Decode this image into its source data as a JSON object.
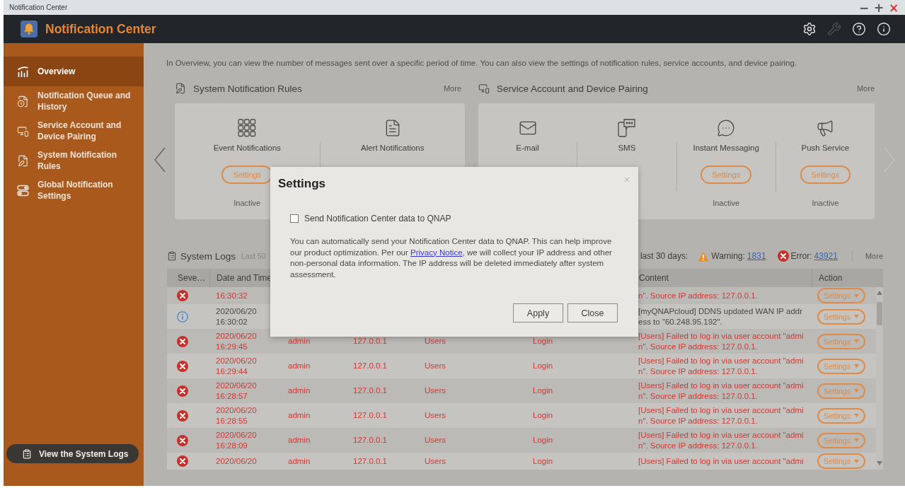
{
  "window": {
    "title": "Notification Center",
    "controls": [
      {
        "kind": "minimize",
        "glyph": "−"
      },
      {
        "kind": "maximize",
        "glyph": "+"
      },
      {
        "kind": "close",
        "glyph": "×"
      }
    ]
  },
  "header": {
    "title": "Notification Center",
    "tools": [
      {
        "kind": "settings",
        "disabled": false
      },
      {
        "kind": "tools",
        "disabled": true
      },
      {
        "kind": "help",
        "disabled": false
      },
      {
        "kind": "info",
        "disabled": false
      }
    ]
  },
  "sidebar": {
    "items": [
      {
        "kind": "overview",
        "label": "Overview",
        "selected": true
      },
      {
        "kind": "history",
        "label": "Notification Queue and History",
        "selected": false
      },
      {
        "kind": "devices",
        "label": "Service Account and Device Pairing",
        "selected": false
      },
      {
        "kind": "rules",
        "label": "System Notification Rules",
        "selected": false
      },
      {
        "kind": "toggles",
        "label": "Global Notification Settings",
        "selected": false
      }
    ],
    "footer_button": "View the System Logs"
  },
  "overview": {
    "description": "In Overview, you can view the number of messages sent over a specific period of time. You can also view the settings of notification rules, service accounts, and device pairing.",
    "carousel": [
      {
        "kind": "previous",
        "disabled": false
      },
      {
        "kind": "next",
        "disabled": true
      }
    ],
    "sections": [
      {
        "kind": "rules",
        "title": "System Notification Rules",
        "more": "More",
        "items": [
          {
            "kind": "event",
            "label": "Event Notifications",
            "button": "Settings",
            "status": "Inactive"
          },
          {
            "kind": "alert",
            "label": "Alert Notifications"
          }
        ]
      },
      {
        "kind": "devices",
        "title": "Service Account and Device Pairing",
        "more": "More",
        "items": [
          {
            "kind": "email",
            "label": "E-mail"
          },
          {
            "kind": "sms",
            "label": "SMS"
          },
          {
            "kind": "chat",
            "label": "Instant Messaging",
            "button": "Settings",
            "status": "Inactive"
          },
          {
            "kind": "push",
            "label": "Push Service",
            "button": "Settings",
            "status": "Inactive"
          }
        ]
      }
    ]
  },
  "system_logs": {
    "title": "System Logs",
    "subtitle": "Last 50",
    "summary": "last 30 days:",
    "counts": [
      {
        "kind": "warning",
        "label": "Warning:",
        "value": "1831"
      },
      {
        "kind": "error",
        "label": "Error:",
        "value": "43921"
      }
    ],
    "more": "More",
    "columns": {
      "severity": "Seve…",
      "date_time": "Date and Time",
      "content": "Content",
      "action": "Action"
    },
    "rows": [
      {
        "kind": "error",
        "time": "16:30:32",
        "content": "n\". Source IP address: 127.0.0.1.",
        "action": "Settings"
      },
      {
        "kind": "info",
        "date": "2020/06/20",
        "time": "16:30:02",
        "content": "[myQNAPcloud] DDNS updated WAN IP address to \"60.248.95.192\".",
        "action": "Settings"
      },
      {
        "kind": "error",
        "date": "2020/06/20",
        "time": "16:29:45",
        "user": "admin",
        "ip": "127.0.0.1",
        "category": "Users",
        "application": "Login",
        "content": "[Users] Failed to log in via user account \"admin\". Source IP address: 127.0.0.1.",
        "action": "Settings"
      },
      {
        "kind": "error",
        "date": "2020/06/20",
        "time": "16:29:44",
        "user": "admin",
        "ip": "127.0.0.1",
        "category": "Users",
        "application": "Login",
        "content": "[Users] Failed to log in via user account \"admin\". Source IP address: 127.0.0.1.",
        "action": "Settings"
      },
      {
        "kind": "error",
        "date": "2020/06/20",
        "time": "16:28:57",
        "user": "admin",
        "ip": "127.0.0.1",
        "category": "Users",
        "application": "Login",
        "content": "[Users] Failed to log in via user account \"admin\". Source IP address: 127.0.0.1.",
        "action": "Settings"
      },
      {
        "kind": "error",
        "date": "2020/06/20",
        "time": "16:28:55",
        "user": "admin",
        "ip": "127.0.0.1",
        "category": "Users",
        "application": "Login",
        "content": "[Users] Failed to log in via user account \"admin\". Source IP address: 127.0.0.1.",
        "action": "Settings"
      },
      {
        "kind": "error",
        "date": "2020/06/20",
        "time": "16:28:09",
        "user": "admin",
        "ip": "127.0.0.1",
        "category": "Users",
        "application": "Login",
        "content": "[Users] Failed to log in via user account \"admin\". Source IP address: 127.0.0.1.",
        "action": "Settings"
      },
      {
        "kind": "error",
        "date": "2020/06/20",
        "user": "admin",
        "ip": "127.0.0.1",
        "category": "Users",
        "application": "Login",
        "content": "[Users] Failed to log in via user account \"admi",
        "action": "Settings"
      }
    ]
  },
  "dialog": {
    "title": "Settings",
    "checkbox": {
      "label": "Send Notification Center data to QNAP",
      "checked": false
    },
    "text_before": "You can automatically send your Notification Center data to QNAP. This can help improve our product optimization. Per our",
    "link": "Privacy Notice",
    "text_after": ", we will collect your IP address and other non-personal data information. The IP address will be deleted immediately after system assessment.",
    "buttons": [
      "Apply",
      "Close"
    ]
  }
}
